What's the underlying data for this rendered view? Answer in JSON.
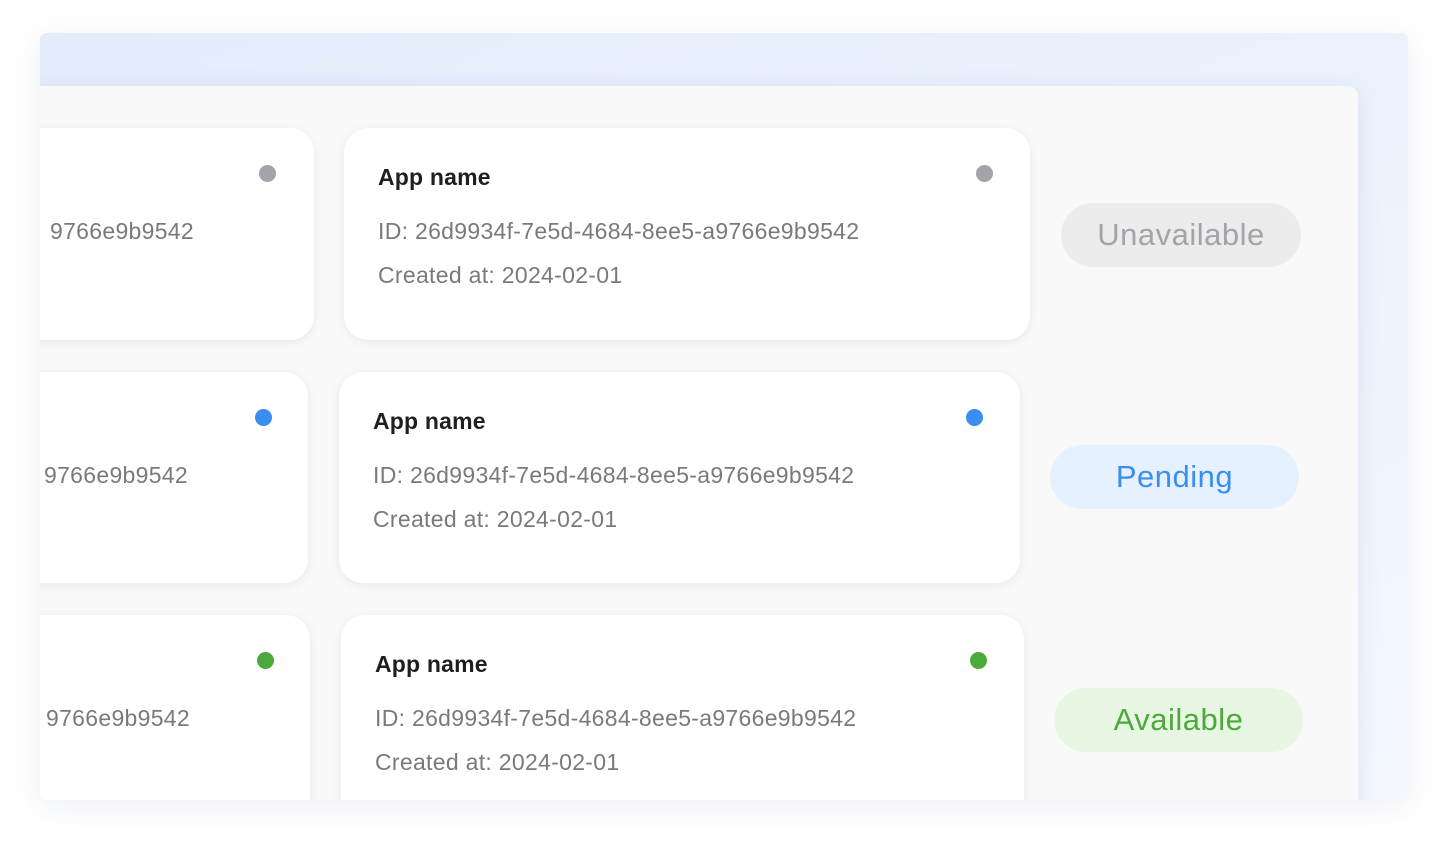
{
  "colors": {
    "unavailable": "#a3a3aa",
    "pending": "#3a8ef2",
    "available": "#4caa3a",
    "unavailable_bg": "#ececec",
    "pending_bg": "#e6f1ff",
    "available_bg": "#e8f6e4"
  },
  "rows": [
    {
      "left_card": {
        "id_fragment": "9766e9b9542"
      },
      "card": {
        "title": "App name",
        "id": "ID: 26d9934f-7e5d-4684-8ee5-a9766e9b9542",
        "created": "Created at: 2024-02-01"
      },
      "status": "Unavailable"
    },
    {
      "left_card": {
        "id_fragment": "9766e9b9542"
      },
      "card": {
        "title": "App name",
        "id": "ID: 26d9934f-7e5d-4684-8ee5-a9766e9b9542",
        "created": "Created at: 2024-02-01"
      },
      "status": "Pending"
    },
    {
      "left_card": {
        "id_fragment": "9766e9b9542"
      },
      "card": {
        "title": "App name",
        "id": "ID: 26d9934f-7e5d-4684-8ee5-a9766e9b9542",
        "created": "Created at: 2024-02-01"
      },
      "status": "Available"
    }
  ]
}
